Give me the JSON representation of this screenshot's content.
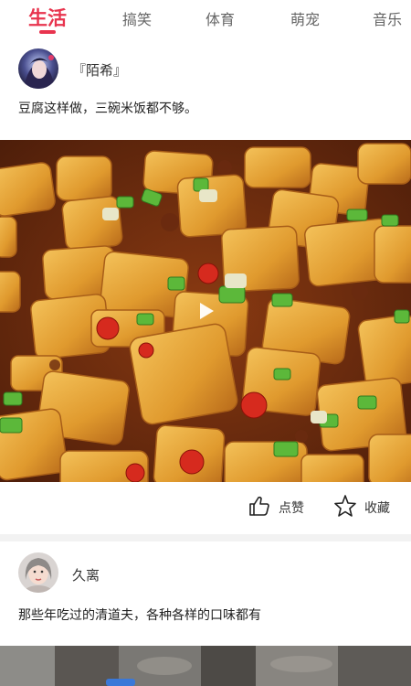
{
  "tabs": [
    {
      "label": "生活",
      "active": true
    },
    {
      "label": "搞笑",
      "active": false
    },
    {
      "label": "体育",
      "active": false
    },
    {
      "label": "萌宠",
      "active": false
    },
    {
      "label": "音乐",
      "active": false
    }
  ],
  "colors": {
    "accent": "#e8344e",
    "text": "#333333",
    "muted": "#666666"
  },
  "posts": [
    {
      "author": "『陌希』",
      "caption": "豆腐这样做，三碗米饭都不够。",
      "media": "video",
      "actions": {
        "like_label": "点赞",
        "like_icon": "thumbs-up-icon",
        "favorite_label": "收藏",
        "favorite_icon": "star-icon"
      }
    },
    {
      "author": "久离",
      "caption": "那些年吃过的清道夫，各种各样的口味都有",
      "media": "image"
    }
  ]
}
